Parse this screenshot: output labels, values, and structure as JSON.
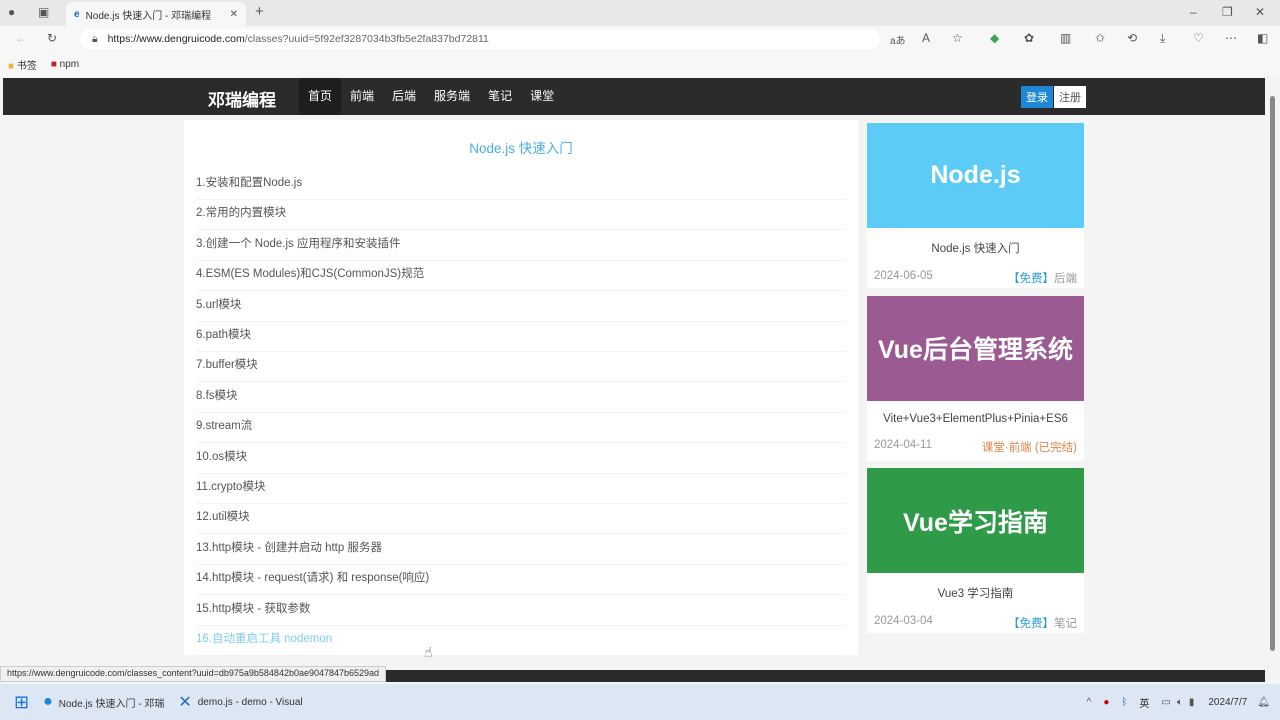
{
  "browser": {
    "tab_title": "Node.js 快速入门 - 邓瑞编程",
    "url_host": "https://www.dengruicode.com",
    "url_path": "/classes?uuid=5f92ef3287034b3fb5e2fa837bd72811",
    "bookmarks": [
      "书签",
      "npm"
    ]
  },
  "nav": {
    "brand": "邓瑞编程",
    "menu": [
      "首页",
      "前端",
      "后端",
      "服务端",
      "笔记",
      "课堂"
    ],
    "login": "登录",
    "register": "注册"
  },
  "main": {
    "title": "Node.js 快速入门",
    "items": [
      "1.安装和配置Node.js",
      "2.常用的内置模块",
      "3.创建一个 Node.js 应用程序和安装插件",
      "4.ESM(ES Modules)和CJS(CommonJS)规范",
      "5.url模块",
      "6.path模块",
      "7.buffer模块",
      "8.fs模块",
      "9.stream流",
      "10.os模块",
      "11.crypto模块",
      "12.util模块",
      "13.http模块 - 创建并启动 http 服务器",
      "14.http模块 - request(请求) 和 response(响应)",
      "15.http模块 - 获取参数",
      "16.自动重启工具 nodemon"
    ]
  },
  "cards": [
    {
      "image_text": "Node.js",
      "color": "#5ccbf7",
      "name": "Node.js 快速入门",
      "date": "2024-06-05",
      "tag": "【免费】",
      "category": "后端"
    },
    {
      "image_text": "Vue后台管理系统",
      "color": "#9c5a93",
      "name": "Vite+Vue3+ElementPlus+Pinia+ES6",
      "date": "2024-04-11",
      "tag": "",
      "category": "课堂·前端 (已完结)"
    },
    {
      "image_text": "Vue学习指南",
      "color": "#2f9b48",
      "name": "Vue3 学习指南",
      "date": "2024-03-04",
      "tag": "【免费】",
      "category": "笔记"
    }
  ],
  "status_url": "https://www.dengruicode.com/classes_content?uuid=db975a9b584842b0ae9047847b6529ad",
  "taskbar": {
    "apps": [
      "Node.js 快速入门 - 邓瑞",
      "demo.js - demo - Visual"
    ],
    "ime": "英",
    "date": "2024/7/7"
  }
}
